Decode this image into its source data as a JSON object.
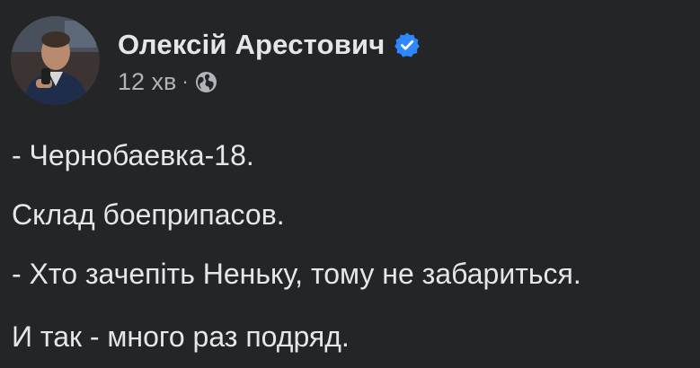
{
  "post": {
    "author_name": "Олексій Арестович",
    "verified_icon": "verified-badge-icon",
    "timestamp": "12 хв",
    "separator": "·",
    "audience_icon": "globe-icon",
    "colors": {
      "background": "#242526",
      "text": "#e4e6eb",
      "secondary_text": "#b0b3b8",
      "verified_blue": "#2d88ff"
    },
    "lines": [
      "- Чернобаевка-18.",
      "Склад боеприпасов.",
      "- Хто зачепіть Неньку, тому не забариться.",
      "И так - много раз подряд."
    ]
  }
}
